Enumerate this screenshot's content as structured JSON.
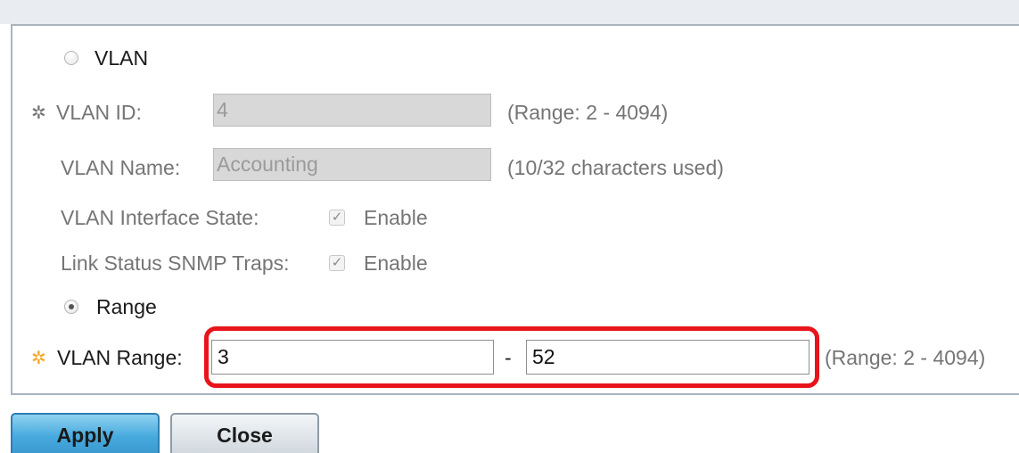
{
  "colors": {
    "accent_blue": "#46a9dd",
    "highlight_red": "#e8141b",
    "required_gear": "#f5a623"
  },
  "form": {
    "vlan_option": {
      "label": "VLAN",
      "selected": false
    },
    "vlan_id": {
      "label": "VLAN ID:",
      "value": "4",
      "hint": "(Range: 2 - 4094)",
      "icon": "gear-icon"
    },
    "vlan_name": {
      "label": "VLAN Name:",
      "value": "Accounting",
      "hint": "(10/32 characters used)"
    },
    "interface_state": {
      "label": "VLAN Interface State:",
      "checkbox_label": "Enable",
      "checked": true
    },
    "snmp_traps": {
      "label": "Link Status SNMP Traps:",
      "checkbox_label": "Enable",
      "checked": true
    },
    "range_option": {
      "label": "Range",
      "selected": true
    },
    "vlan_range": {
      "label": "VLAN Range:",
      "from": "3",
      "separator": "-",
      "to": "52",
      "hint": "(Range: 2 - 4094)",
      "icon": "gear-icon"
    }
  },
  "buttons": {
    "apply": "Apply",
    "close": "Close"
  }
}
